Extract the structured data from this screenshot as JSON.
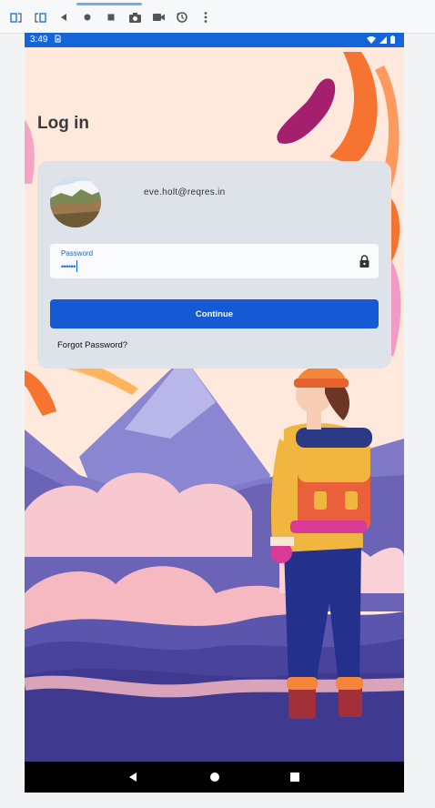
{
  "emulator_toolbar": {
    "buttons": [
      {
        "icon": "rotate-left-icon"
      },
      {
        "icon": "rotate-right-icon"
      },
      {
        "icon": "back-icon"
      },
      {
        "icon": "home-icon"
      },
      {
        "icon": "overview-icon"
      },
      {
        "icon": "camera-icon"
      },
      {
        "icon": "video-icon"
      },
      {
        "icon": "snapshot-icon"
      },
      {
        "icon": "more-icon"
      }
    ]
  },
  "status_bar": {
    "time": "3:49",
    "sim_icon": "sim-icon",
    "icons": [
      "wifi-icon",
      "signal-icon",
      "battery-icon"
    ]
  },
  "login": {
    "title": "Log in",
    "email": "eve.holt@reqres.in",
    "password_label": "Password",
    "password_value": "••••••",
    "continue_label": "Continue",
    "forgot_label": "Forgot Password?"
  },
  "colors": {
    "status_bar": "#1565d8",
    "primary": "#1559d4",
    "card": "#dde3e9",
    "background": "#ffe9dc"
  }
}
